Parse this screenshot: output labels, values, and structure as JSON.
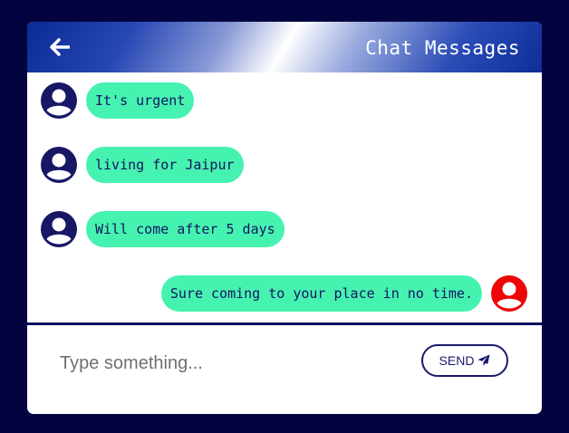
{
  "colors": {
    "page_bg": "#03033f",
    "bubble": "#46f2b0",
    "avatar_other": "#171766",
    "avatar_self": "#ee0606",
    "text_dark": "#161660"
  },
  "header": {
    "back_icon": "arrow-left-icon",
    "title": "Chat Messages"
  },
  "messages": [
    {
      "text": "It's urgent",
      "side": "left",
      "avatar_icon": "user-avatar-icon"
    },
    {
      "text": "living for Jaipur",
      "side": "left",
      "avatar_icon": "user-avatar-icon"
    },
    {
      "text": "Will come after 5 days",
      "side": "left",
      "avatar_icon": "user-avatar-icon"
    },
    {
      "text": "Sure coming to your place in no time.",
      "side": "right",
      "avatar_icon": "user-avatar-icon"
    }
  ],
  "composer": {
    "placeholder": "Type something...",
    "value": "",
    "send_label": "SEND",
    "send_icon": "paper-plane-icon"
  }
}
